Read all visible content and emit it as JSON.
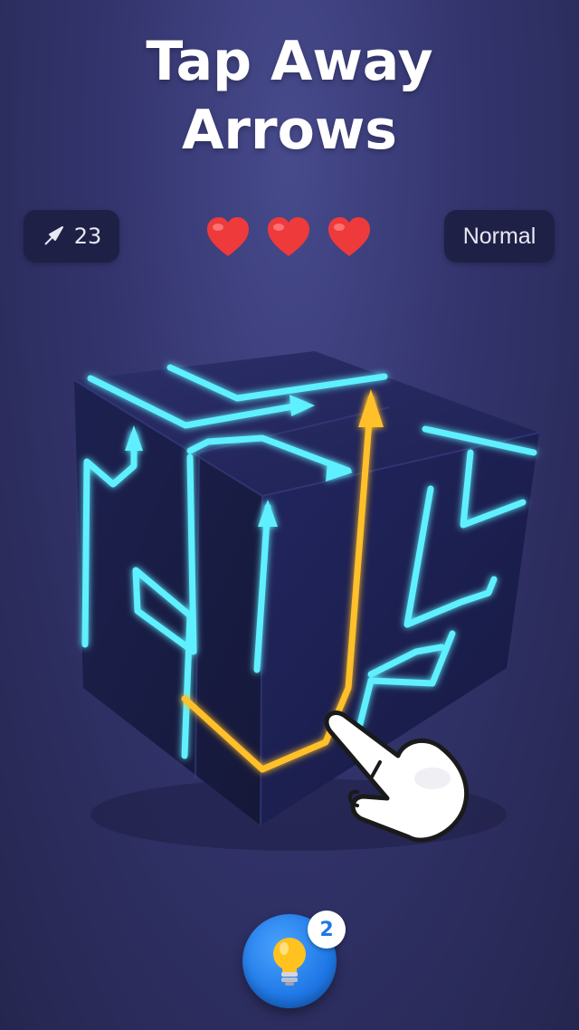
{
  "title": {
    "line1": "Tap Away",
    "line2": "Arrows"
  },
  "hud": {
    "moves_icon": "arrow-icon",
    "moves_count": "23",
    "lives": 3,
    "mode_label": "Normal"
  },
  "hint": {
    "icon": "lightbulb-icon",
    "count": "2"
  },
  "colors": {
    "background": "#33346d",
    "arrow_cyan": "#5ff0ff",
    "arrow_selected": "#ffc02a",
    "heart": "#ee3a3a",
    "hint_button": "#1f78e6"
  }
}
